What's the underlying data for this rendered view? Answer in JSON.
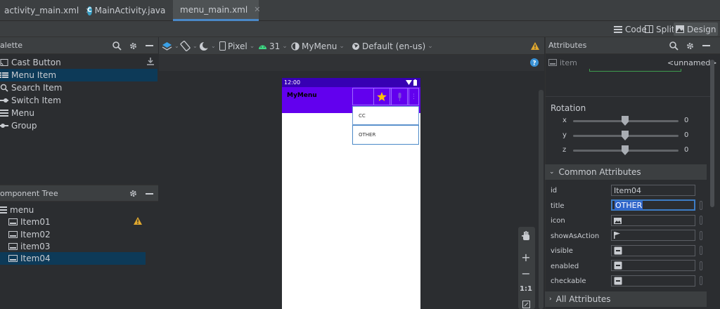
{
  "tabs": [
    {
      "label": "activity_main.xml",
      "icon": "xml-file-icon"
    },
    {
      "label": "MainActivity.java",
      "icon": "java-class-icon"
    },
    {
      "label": "menu_main.xml",
      "icon": "xml-file-icon",
      "active": true
    }
  ],
  "view_modes": {
    "code": "Code",
    "split": "Split",
    "design": "Design"
  },
  "palette": {
    "title": "alette",
    "items": [
      "Cast Button",
      "Menu Item",
      "Search Item",
      "Switch Item",
      "Menu",
      "Group"
    ]
  },
  "component_tree": {
    "title": "omponent Tree",
    "root": "menu",
    "items": [
      "Item01",
      "Item02",
      "item03",
      "Item04"
    ]
  },
  "design_toolbar": {
    "device": "Pixel",
    "api": "31",
    "theme": "MyMenu",
    "locale": "Default (en-us)"
  },
  "phone": {
    "time": "12:00",
    "app_title": "MyMenu",
    "menu_items": [
      "CC",
      "OTHER"
    ]
  },
  "attributes_panel": {
    "title": "Attributes",
    "component": "item",
    "id_value": "<unnamed>",
    "rotation": {
      "label": "Rotation",
      "x_label": "x",
      "y_label": "y",
      "z_label": "z",
      "x": "0",
      "y": "0",
      "z": "0"
    },
    "common_section": "Common Attributes",
    "all_section": "All Attributes",
    "fields": {
      "id": {
        "label": "id",
        "value": "Item04"
      },
      "title": {
        "label": "title",
        "value": "OTHER"
      },
      "icon": {
        "label": "icon"
      },
      "showAsAction": {
        "label": "showAsAction"
      },
      "visible": {
        "label": "visible"
      },
      "enabled": {
        "label": "enabled"
      },
      "checkable": {
        "label": "checkable"
      }
    }
  },
  "zoom": {
    "ratio": "1:1"
  },
  "colors": {
    "primary": "#6200ee",
    "primary_dark": "#3700b3",
    "selection": "#0d3a58",
    "accent_tab": "#4a88c7"
  }
}
